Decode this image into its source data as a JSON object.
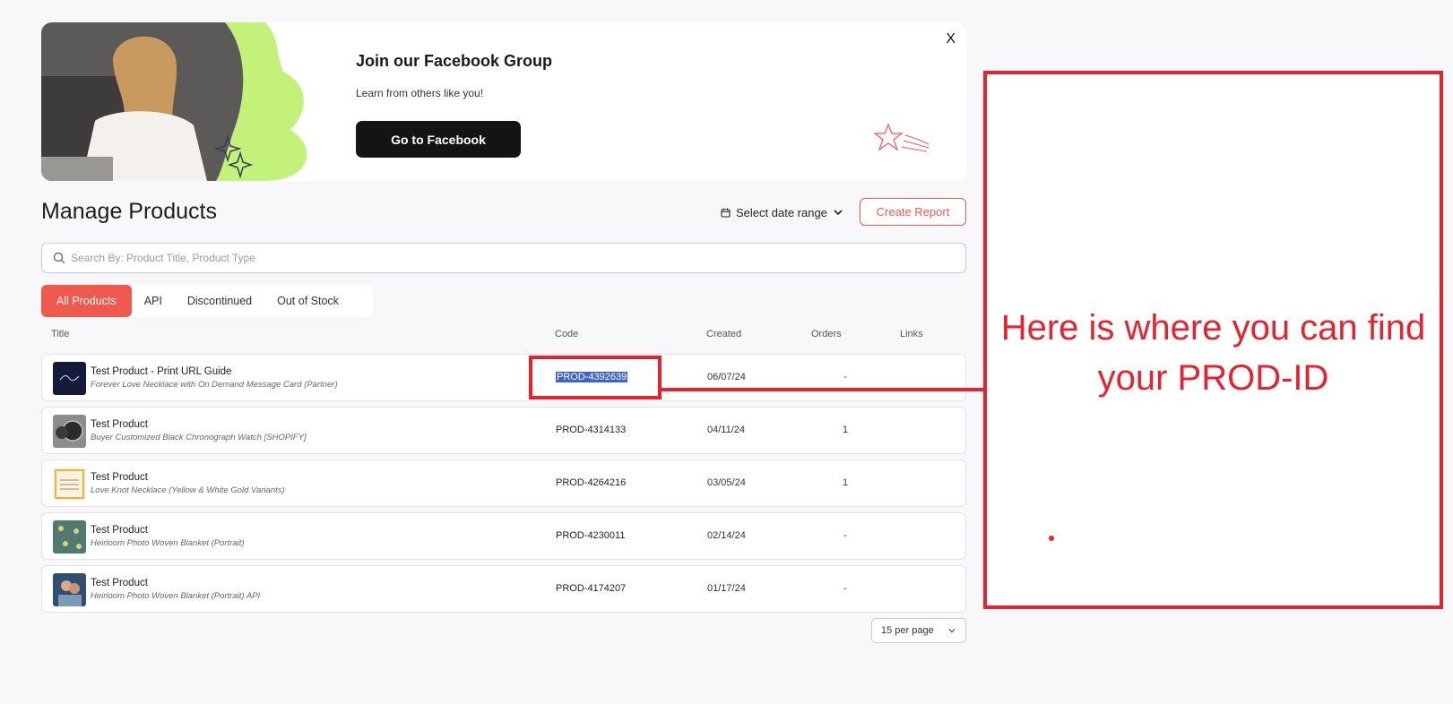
{
  "banner": {
    "title": "Join our Facebook Group",
    "subtitle": "Learn from others like you!",
    "button_label": "Go to Facebook",
    "close_label": "X",
    "accent_color": "#c3f27a"
  },
  "header": {
    "title": "Manage Products",
    "date_range_label": "Select date range",
    "create_report_label": "Create Report"
  },
  "search": {
    "placeholder": "Search By: Product Title, Product Type",
    "value": ""
  },
  "tabs": [
    {
      "label": "All Products",
      "active": true
    },
    {
      "label": "API",
      "active": false
    },
    {
      "label": "Discontinued",
      "active": false
    },
    {
      "label": "Out of Stock",
      "active": false
    }
  ],
  "table": {
    "columns": [
      "Title",
      "Code",
      "Created",
      "Orders",
      "Links"
    ],
    "rows": [
      {
        "title": "Test Product - Print URL Guide",
        "subtitle": "Forever Love Necklace with On Demand Message Card (Partner)",
        "code": "PROD-4392639",
        "created": "06/07/24",
        "orders": "-",
        "links": ""
      },
      {
        "title": "Test Product",
        "subtitle": "Buyer Customized Black Chronograph Watch [SHOPIFY]",
        "code": "PROD-4314133",
        "created": "04/11/24",
        "orders": "1",
        "links": ""
      },
      {
        "title": "Test Product",
        "subtitle": "Love Knot Necklace (Yellow & White Gold Variants)",
        "code": "PROD-4264216",
        "created": "03/05/24",
        "orders": "1",
        "links": ""
      },
      {
        "title": "Test Product",
        "subtitle": "Heirloom Photo Woven Blanket (Portrait)",
        "code": "PROD-4230011",
        "created": "02/14/24",
        "orders": "-",
        "links": ""
      },
      {
        "title": "Test Product",
        "subtitle": "Heirloom Photo Woven Blanket (Portrait) API",
        "code": "PROD-4174207",
        "created": "01/17/24",
        "orders": "-",
        "links": ""
      }
    ]
  },
  "pagination": {
    "per_page_label": "15 per page"
  },
  "annotation": {
    "text": "Here is where you can find your PROD-ID",
    "color": "#e5222d"
  }
}
